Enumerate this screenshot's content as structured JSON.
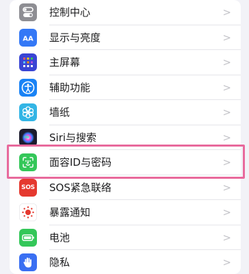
{
  "settings": {
    "items": [
      {
        "label": "控制中心",
        "icon": "control-center-icon",
        "color": "#8e8e93"
      },
      {
        "label": "显示与亮度",
        "icon": "display-brightness-icon",
        "color": "#3478f6"
      },
      {
        "label": "主屏幕",
        "icon": "home-screen-icon",
        "color": "#3a45d4"
      },
      {
        "label": "辅助功能",
        "icon": "accessibility-icon",
        "color": "#1a83f5"
      },
      {
        "label": "墙纸",
        "icon": "wallpaper-icon",
        "color": "#33b5e5"
      },
      {
        "label": "Siri与搜索",
        "icon": "siri-icon",
        "color": "#1c1c2e"
      },
      {
        "label": "面容ID与密码",
        "icon": "face-id-icon",
        "color": "#34c759"
      },
      {
        "label": "SOS紧急联络",
        "icon": "sos-icon",
        "color": "#e5392f"
      },
      {
        "label": "暴露通知",
        "icon": "exposure-notification-icon",
        "color": "#ffffff"
      },
      {
        "label": "电池",
        "icon": "battery-icon",
        "color": "#34c759"
      },
      {
        "label": "隐私",
        "icon": "privacy-hand-icon",
        "color": "#3a6ff2"
      }
    ],
    "sos_icon_text": "SOS"
  },
  "highlight": {
    "target": "面容ID与密码",
    "color": "#e8699c"
  }
}
